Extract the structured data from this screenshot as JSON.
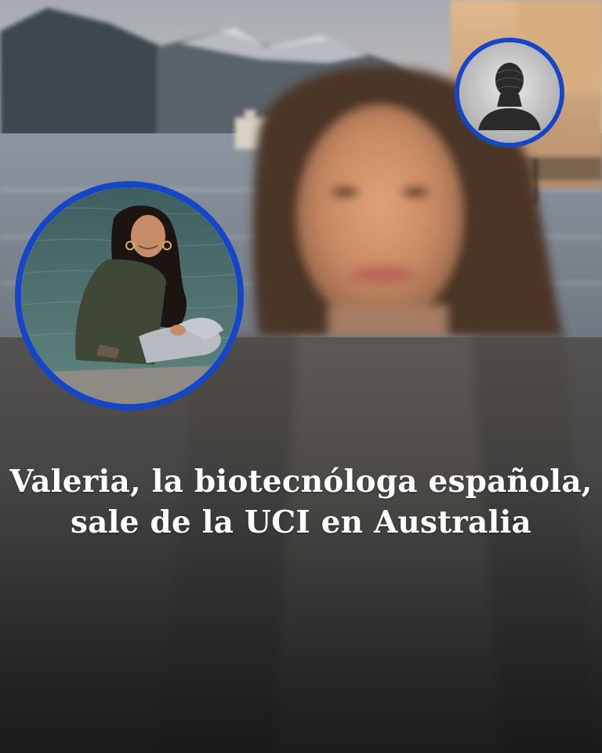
{
  "post": {
    "headline": {
      "line1": "Valeria, la biotecnóloga española,",
      "line2": "sale de la UCI en Australia"
    }
  },
  "photos": {
    "background": "woman-portrait-lakeside",
    "inset_left": "woman-sitting-by-lake",
    "inset_right": "silhouette-placeholder-icon"
  },
  "colors": {
    "ring": "#1546c9",
    "headline_text": "#ffffff"
  }
}
